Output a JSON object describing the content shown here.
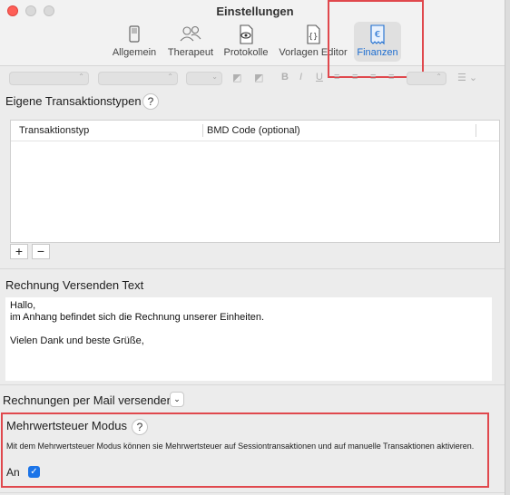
{
  "window": {
    "title": "Einstellungen"
  },
  "toolbar": {
    "items": [
      {
        "label": "Allgemein",
        "icon": "switch-icon"
      },
      {
        "label": "Therapeut",
        "icon": "people-icon"
      },
      {
        "label": "Protokolle",
        "icon": "eye-document-icon"
      },
      {
        "label": "Vorlagen Editor",
        "icon": "braces-document-icon"
      },
      {
        "label": "Finanzen",
        "icon": "euro-receipt-icon",
        "selected": true
      }
    ]
  },
  "transactions": {
    "heading": "Eigene Transaktionstypen",
    "help": "?",
    "columns": [
      "Transaktionstyp",
      "BMD Code (optional)"
    ],
    "add_label": "+",
    "remove_label": "−"
  },
  "invoice_text": {
    "heading": "Rechnung Versenden Text",
    "line1": "Hallo,",
    "line2": "im Anhang befindet sich die Rechnung unserer Einheiten.",
    "line3": "Vielen Dank und beste Grüße,"
  },
  "mail": {
    "label": "Rechnungen per Mail versenden"
  },
  "vat": {
    "heading": "Mehrwertsteuer Modus",
    "help": "?",
    "description": "Mit dem Mehrwertsteuer Modus können sie Mehrwertsteuer auf Sessiontransaktionen und auf manuelle Transaktionen aktivieren.",
    "toggle_label": "An",
    "enabled": true
  },
  "colors": {
    "highlight": "#e0484d",
    "accent": "#1b74e8"
  }
}
